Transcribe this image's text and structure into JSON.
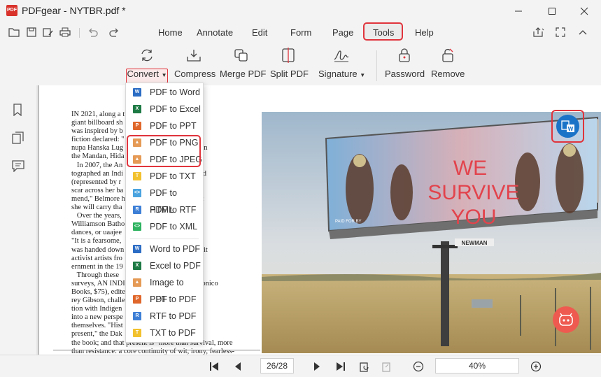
{
  "app": {
    "logo_text": "PDF",
    "title": "PDFgear - NYTBR.pdf *"
  },
  "window_controls": {
    "minimize": "minimize",
    "maximize": "maximize",
    "close": "close"
  },
  "menu": {
    "tabs": [
      "Home",
      "Annotate",
      "Edit",
      "Form",
      "Page",
      "Tools",
      "Help"
    ],
    "active": "Tools"
  },
  "ribbon": {
    "convert": "Convert",
    "compress": "Compress",
    "merge": "Merge PDF",
    "split": "Split PDF",
    "signature": "Signature",
    "password": "Password",
    "remove": "Remove"
  },
  "convert_menu": {
    "items": [
      {
        "label": "PDF to Word",
        "icon": "W",
        "color": "#2b6cc4"
      },
      {
        "label": "PDF to Excel",
        "icon": "X",
        "color": "#1e7a44"
      },
      {
        "label": "PDF to PPT",
        "icon": "P",
        "color": "#e0672b"
      },
      {
        "label": "PDF to PNG",
        "icon": "img",
        "color": "#e59a55"
      },
      {
        "label": "PDF to JPEG",
        "icon": "img",
        "color": "#e59a55"
      },
      {
        "label": "PDF to TXT",
        "icon": "T",
        "color": "#f2c12e"
      },
      {
        "label": "PDF to HTML",
        "icon": "<>",
        "color": "#4aa3df"
      },
      {
        "label": "PDF to RTF",
        "icon": "R",
        "color": "#3d7fd6"
      },
      {
        "label": "PDF to XML",
        "icon": "<>",
        "color": "#2fb361"
      },
      {
        "label": "Word to PDF",
        "icon": "W",
        "color": "#2b6cc4"
      },
      {
        "label": "Excel to PDF",
        "icon": "X",
        "color": "#1e7a44"
      },
      {
        "label": "Image to PDF",
        "icon": "img",
        "color": "#e59a55"
      },
      {
        "label": "PPT to PDF",
        "icon": "P",
        "color": "#e0672b"
      },
      {
        "label": "RTF to PDF",
        "icon": "R",
        "color": "#3d7fd6"
      },
      {
        "label": "TXT to PDF",
        "icon": "T",
        "color": "#f2c12e"
      }
    ]
  },
  "document": {
    "lines": [
      "IN 2021, along a tw                    an, N.D., a",
      "giant billboard sh                      clothing that",
      "was inspired by b                       and science",
      "fiction declared: \"                     artist, Can-",
      "nupa Hanska Lug                       ers enrolled in",
      "the Mandan, Hida                      today.",
      "   In 2007, the An                    Belmore pho-",
      "tographed an Indi                     ringe\" of blood",
      "(represented by r                     a diagonal",
      "scar across her ba                    that is on the",
      "mend,\" Belmore h                    and go on, but",
      "she will carry tha",
      "   Over the years,                     kuluk",
      "Williamson Batho                     landic mask",
      "dances, or uaajee                     nd the world:",
      "\"It is a fearsome,                    itten, \"that",
      "was handed down                      and other Inuit",
      "activist artists fro                 l to self-gov-",
      "ernment in the 19",
      "   Through these                      r works it",
      "surveys, AN INDIG                    Press/DelMonico",
      "Books, $75), edited                  w artist Jeff-",
      "rey Gibson, challe                   uctive fascina-",
      "tion with Indigen                    nd inviting it",
      "into a new perspe                    nous artists",
      "themselves. \"Hist                    he Indigenous",
      "present,\" the Dak                    ria writes in",
      "the book; and that present is \"more than survival, more",
      "than resistance: a core continuity of wit, irony, fearless-"
    ],
    "billboard": {
      "line1": "WE",
      "line2": "SURVIVE",
      "line3": "YOU",
      "brand": "NEWMAN",
      "paid": "PAID FOR BY"
    }
  },
  "footer": {
    "page": "26/28",
    "zoom": "40%"
  }
}
